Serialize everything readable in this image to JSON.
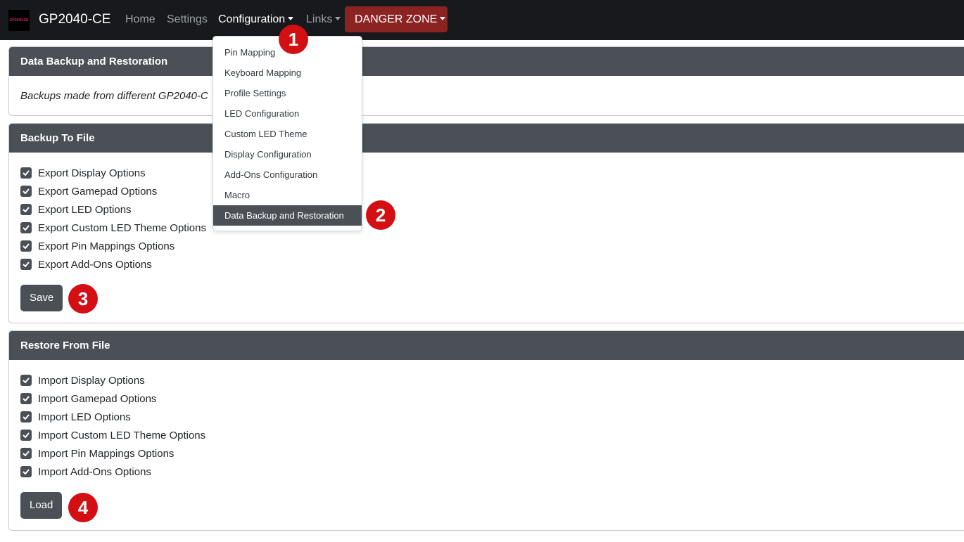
{
  "navbar": {
    "logo_text": "GP2040-CE",
    "brand": "GP2040-CE",
    "links": {
      "home": "Home",
      "settings": "Settings",
      "configuration": "Configuration",
      "links": "Links"
    },
    "danger_zone": "DANGER ZONE"
  },
  "dropdown": {
    "items": [
      "Pin Mapping",
      "Keyboard Mapping",
      "Profile Settings",
      "LED Configuration",
      "Custom LED Theme",
      "Display Configuration",
      "Add-Ons Configuration",
      "Macro",
      "Data Backup and Restoration"
    ]
  },
  "intro_card": {
    "title": "Data Backup and Restoration",
    "description": "Backups made from different GP2040-C"
  },
  "backup_card": {
    "title": "Backup To File",
    "options": [
      "Export Display Options",
      "Export Gamepad Options",
      "Export LED Options",
      "Export Custom LED Theme Options",
      "Export Pin Mappings Options",
      "Export Add-Ons Options"
    ],
    "button": "Save"
  },
  "restore_card": {
    "title": "Restore From File",
    "options": [
      "Import Display Options",
      "Import Gamepad Options",
      "Import LED Options",
      "Import Custom LED Theme Options",
      "Import Pin Mappings Options",
      "Import Add-Ons Options"
    ],
    "button": "Load"
  },
  "steps": [
    "1",
    "2",
    "3",
    "4"
  ],
  "colors": {
    "navbar": "#17191c",
    "danger": "#8b2323",
    "header": "#4b5057",
    "step_marker": "#d40f14"
  }
}
